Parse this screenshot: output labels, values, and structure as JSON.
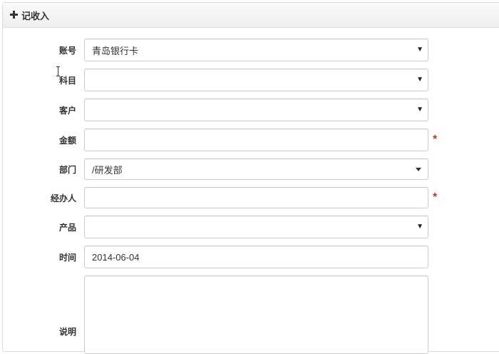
{
  "panel": {
    "title": "记收入",
    "icon": "plus-icon"
  },
  "form": {
    "fields": [
      {
        "label": "账号",
        "value": "青岛银行卡",
        "type": "select"
      },
      {
        "label": "科目",
        "value": "",
        "type": "select"
      },
      {
        "label": "客户",
        "value": "",
        "type": "select"
      },
      {
        "label": "金额",
        "value": "",
        "type": "text",
        "required_mark": "*"
      },
      {
        "label": "部门",
        "value": "/研发部",
        "type": "select"
      },
      {
        "label": "经办人",
        "value": "",
        "type": "text",
        "required_mark": "*"
      },
      {
        "label": "产品",
        "value": "",
        "type": "select"
      },
      {
        "label": "时间",
        "value": "2014-06-04",
        "type": "text"
      },
      {
        "label": "说明",
        "value": "",
        "type": "textarea"
      }
    ]
  },
  "colors": {
    "required": "#c0392b",
    "border": "#cccccc",
    "heading_bg": "#f5f5f5"
  }
}
